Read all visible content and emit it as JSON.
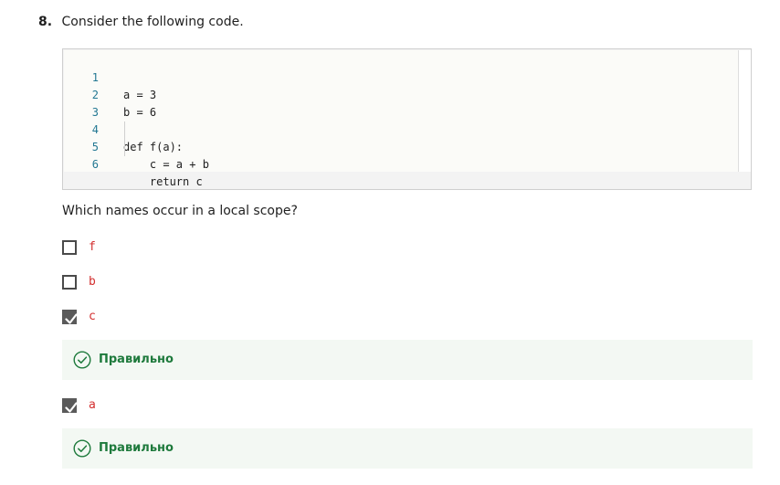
{
  "question": {
    "number": "8.",
    "title": "Consider the following code."
  },
  "code": {
    "lines": [
      {
        "num": "1",
        "text": "a = 3"
      },
      {
        "num": "2",
        "text": "b = 6"
      },
      {
        "num": "3",
        "text": ""
      },
      {
        "num": "4",
        "text": "def f(a):"
      },
      {
        "num": "5",
        "text": "    c = a + b"
      },
      {
        "num": "6",
        "text": "    return c"
      }
    ]
  },
  "prompt": "Which names occur in a local scope?",
  "options": [
    {
      "label": "f",
      "checked": false
    },
    {
      "label": "b",
      "checked": false
    },
    {
      "label": "c",
      "checked": true
    },
    {
      "label": "a",
      "checked": true
    }
  ],
  "feedback": [
    {
      "text": "Правильно",
      "icon": "check-circle-icon"
    },
    {
      "text": "Правильно",
      "icon": "check-circle-icon"
    }
  ],
  "colors": {
    "option_label": "#d32f2f",
    "correct_text": "#1e7a3c",
    "correct_background": "#f3f8f3",
    "line_number": "#237893",
    "checkbox_checked": "#5a5a5a"
  }
}
